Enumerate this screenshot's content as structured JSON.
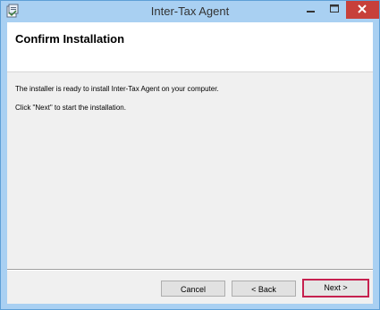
{
  "window": {
    "title": "Inter-Tax Agent",
    "icons": {
      "app": "installer-icon",
      "minimize": "minimize-icon",
      "maximize": "maximize-icon",
      "close": "close-icon"
    },
    "colors": {
      "titlebar": "#a9d0f2",
      "close": "#c7403a",
      "highlight": "#c6214f"
    }
  },
  "page": {
    "heading": "Confirm Installation",
    "lines": [
      "The installer is ready to install Inter-Tax Agent on your computer.",
      "Click \"Next\" to start the installation."
    ]
  },
  "buttons": {
    "cancel": "Cancel",
    "back": "< Back",
    "next": "Next >"
  }
}
